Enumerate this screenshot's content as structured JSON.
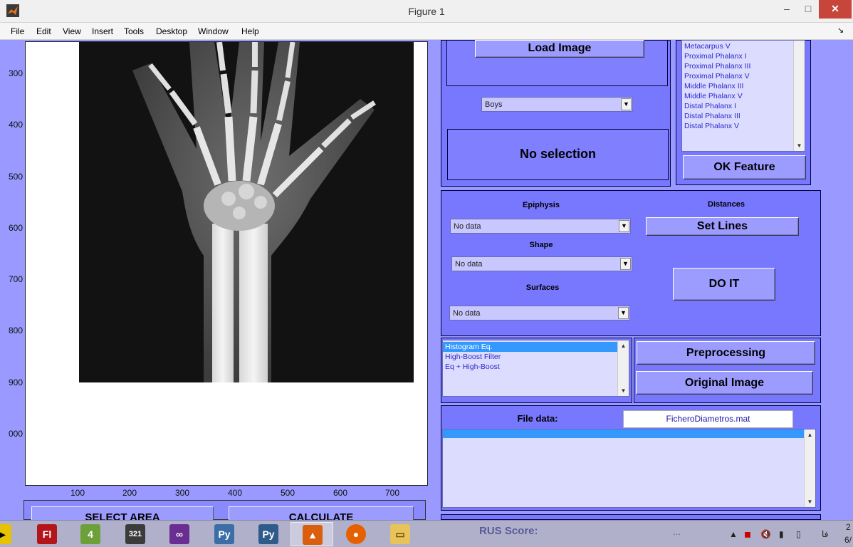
{
  "window": {
    "title": "Figure 1",
    "minimize": "–",
    "maximize": "□",
    "close": "✕"
  },
  "menu": {
    "items": [
      "File",
      "Edit",
      "View",
      "Insert",
      "Tools",
      "Desktop",
      "Window",
      "Help"
    ],
    "dock_symbol": "↘"
  },
  "axes": {
    "y_ticks": [
      "300",
      "400",
      "500",
      "600",
      "700",
      "800",
      "900",
      "000"
    ],
    "x_ticks": [
      "100",
      "200",
      "300",
      "400",
      "500",
      "600",
      "700"
    ]
  },
  "left_buttons": {
    "select_area": "SELECT AREA",
    "calculate": "CALCULATE"
  },
  "load_panel": {
    "load_button": "Load Image",
    "gender_select": "Boys",
    "status_text": "No selection"
  },
  "feature_panel": {
    "bones": [
      "Metacarpus V",
      "Proximal Phalanx I",
      "Proximal Phalanx III",
      "Proximal Phalanx V",
      "Middle Phalanx III",
      "Middle Phalanx V",
      "Distal Phalanx I",
      "Distal Phalanx III",
      "Distal Phalanx V"
    ],
    "ok_button": "OK Feature"
  },
  "analysis_panel": {
    "epiphysis_label": "Epiphysis",
    "epiphysis_value": "No data",
    "shape_label": "Shape",
    "shape_value": "No data",
    "surfaces_label": "Surfaces",
    "surfaces_value": "No data",
    "distances_label": "Distances",
    "set_lines_button": "Set Lines",
    "do_it_button": "DO IT"
  },
  "preprocess_panel": {
    "options": [
      "Histogram Eq.",
      "High-Boost Filter",
      "Eq + High-Boost"
    ],
    "selected_index": 0,
    "preprocessing_button": "Preprocessing",
    "original_button": "Original Image"
  },
  "file_panel": {
    "label": "File data:",
    "filename": "FicheroDiametros.mat"
  },
  "rus_panel": {
    "label": "RUS Score:",
    "value": "..."
  },
  "taskbar": {
    "apps": [
      "labview-icon",
      "flash-icon",
      "mathematica-icon",
      "media-player-icon",
      "visual-studio-icon",
      "python-icon",
      "python-idle-icon",
      "matlab-icon",
      "firefox-icon",
      "file-explorer-icon"
    ],
    "tray_locale": "فا",
    "clock_partial": "2",
    "date_partial": "6/"
  },
  "colors": {
    "workspace": "#9999ff",
    "panel": "#7878ff",
    "button": "#9c9cff",
    "list_selection": "#3399ff",
    "close_button": "#c7463b"
  }
}
